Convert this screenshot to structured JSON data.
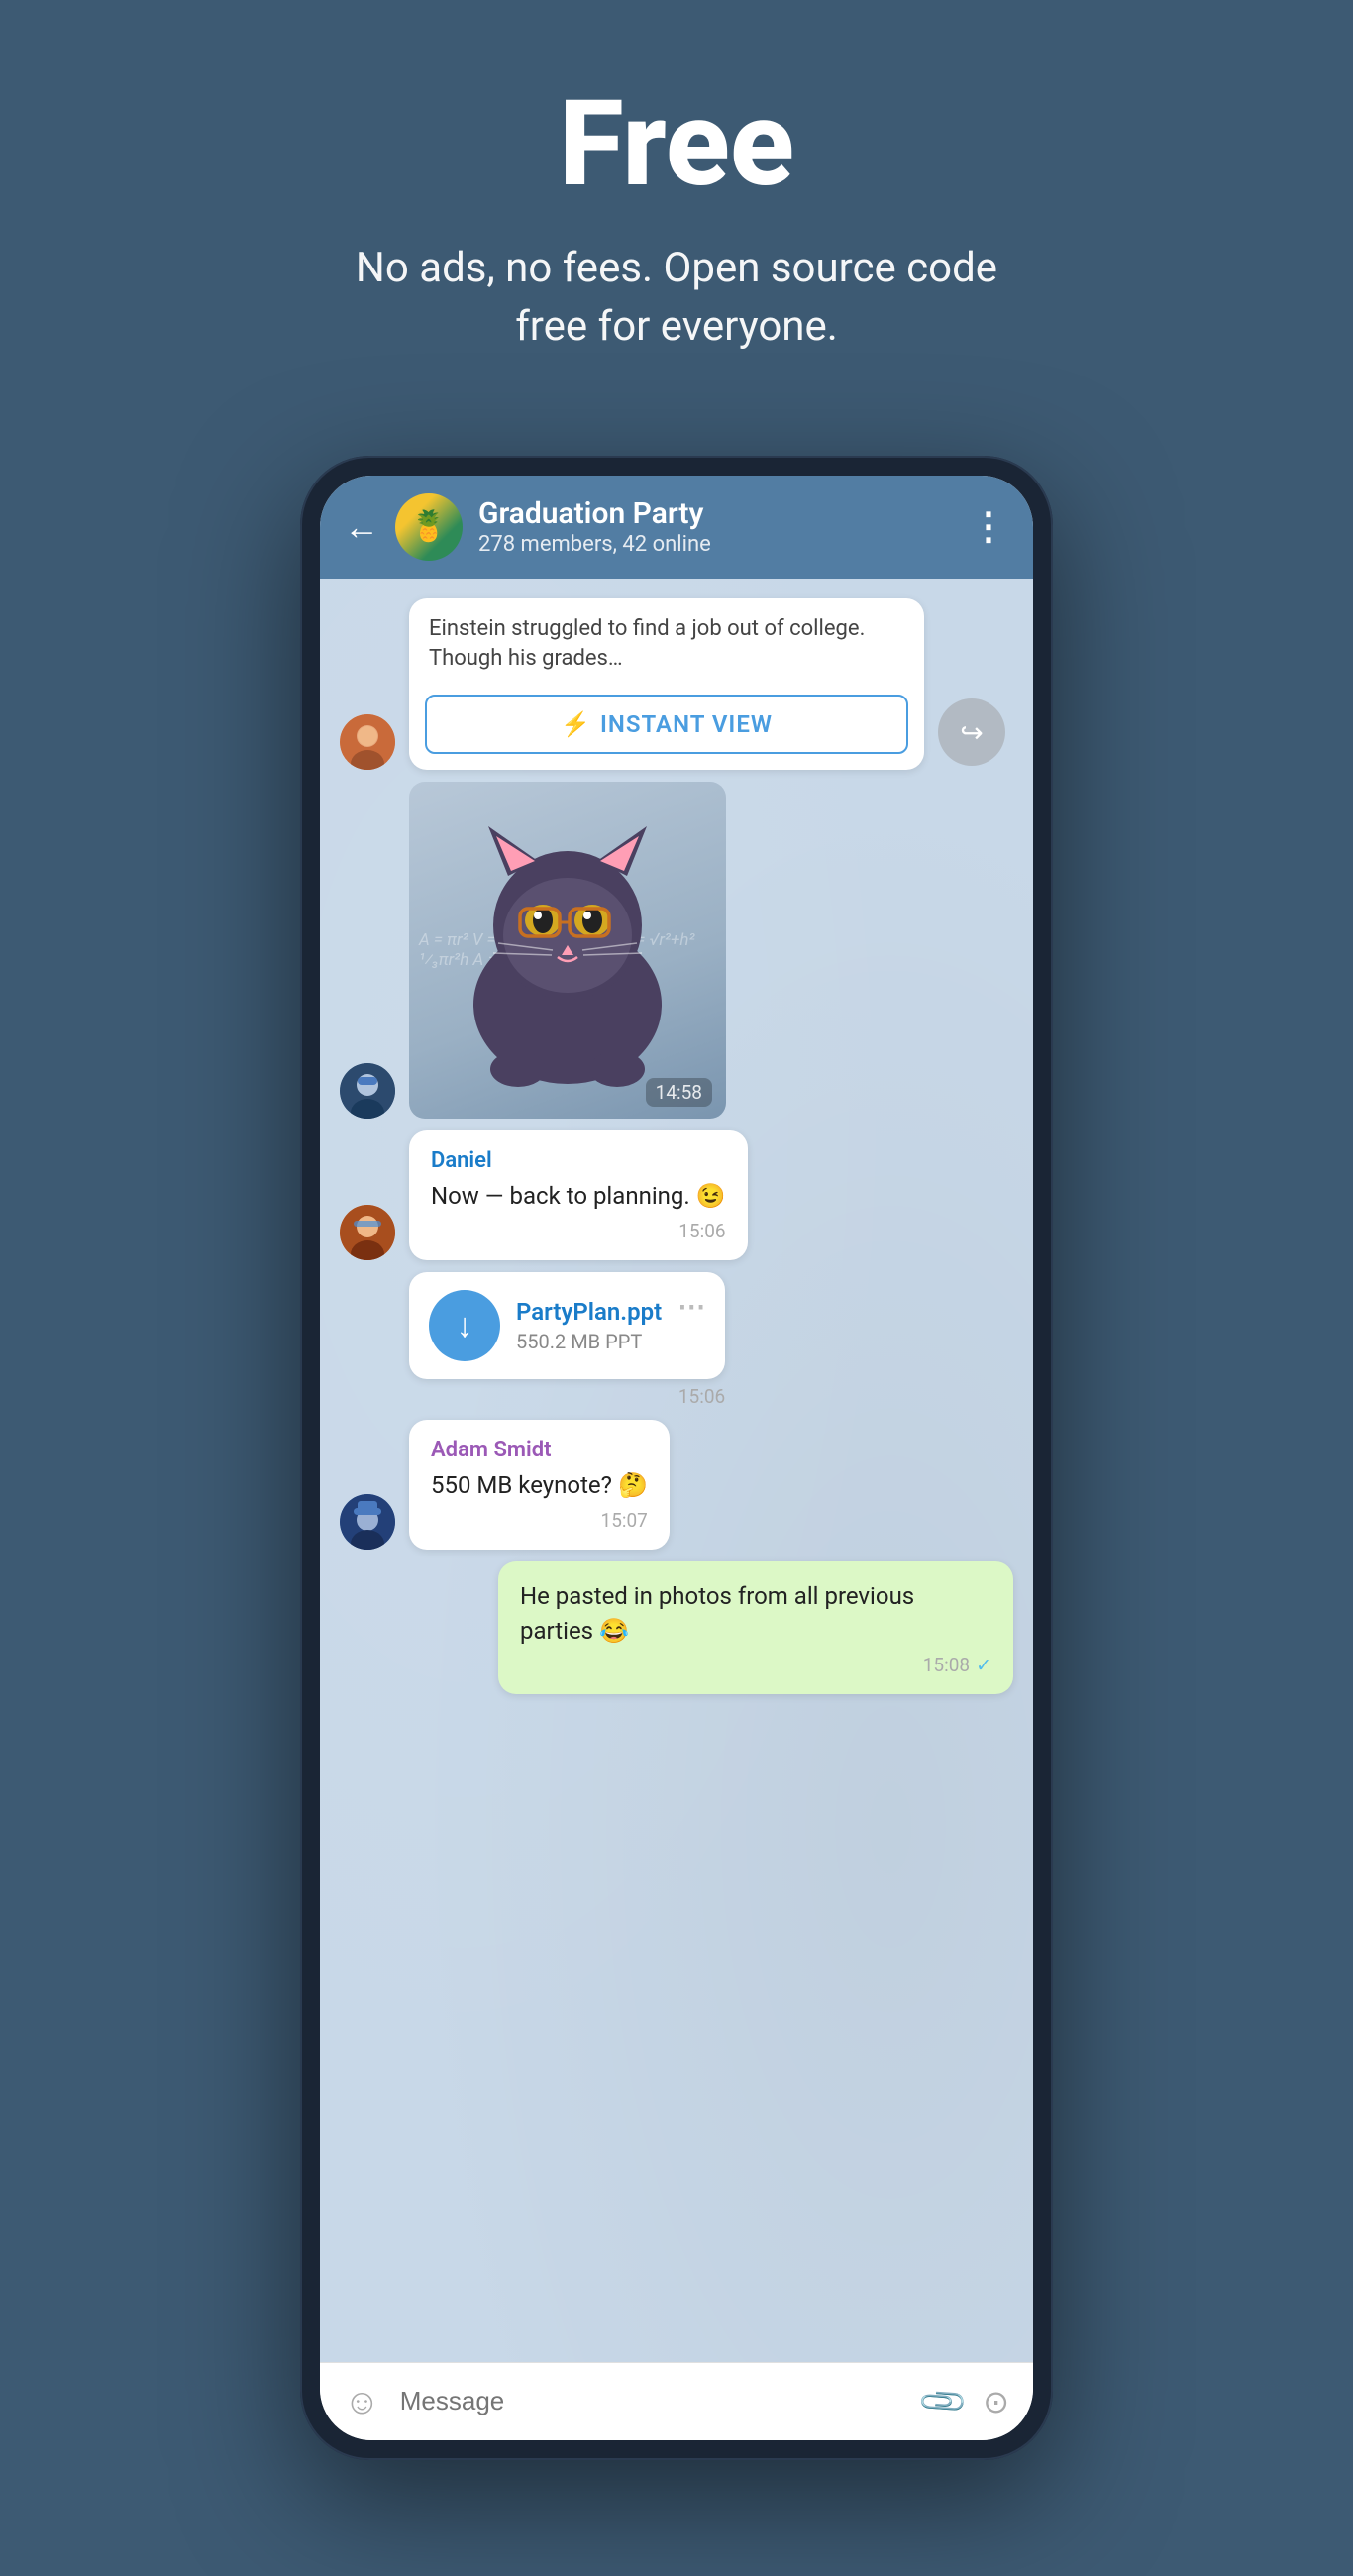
{
  "hero": {
    "title": "Free",
    "subtitle": "No ads, no fees. Open source code free for everyone."
  },
  "header": {
    "group_name": "Graduation Party",
    "member_info": "278 members, 42 online",
    "avatar_emoji": "🍍",
    "back_label": "←",
    "menu_dots": "⋮"
  },
  "messages": [
    {
      "id": "iv_msg",
      "type": "instant_view",
      "text": "Einstein struggled to find a job out of college. Though his grades…",
      "iv_btn_label": "INSTANT VIEW",
      "iv_lightning": "⚡"
    },
    {
      "id": "sticker_msg",
      "type": "sticker",
      "time": "14:58",
      "avatar_type": "boy"
    },
    {
      "id": "daniel_msg",
      "type": "text",
      "sender": "Daniel",
      "text": "Now — back to planning. 😉",
      "time": "15:06",
      "avatar_type": "man"
    },
    {
      "id": "file_msg",
      "type": "file",
      "file_name": "PartyPlan.ppt",
      "file_size": "550.2 MB PPT",
      "time": "15:06",
      "avatar_type": "none"
    },
    {
      "id": "adam_msg",
      "type": "text",
      "sender": "Adam Smidt",
      "text": "550 MB keynote? 🤔",
      "time": "15:07",
      "avatar_type": "hat"
    },
    {
      "id": "outgoing_msg",
      "type": "text_outgoing",
      "text": "He pasted in photos from all previous parties 😂",
      "time": "15:08",
      "check": "✓"
    }
  ],
  "input_bar": {
    "placeholder": "Message"
  },
  "colors": {
    "header_bg": "#527da3",
    "chat_bg": "#c8d8e8",
    "accent_blue": "#4a9de0",
    "outgoing_bg": "#dcf8c6",
    "page_bg": "#3d5a73"
  }
}
